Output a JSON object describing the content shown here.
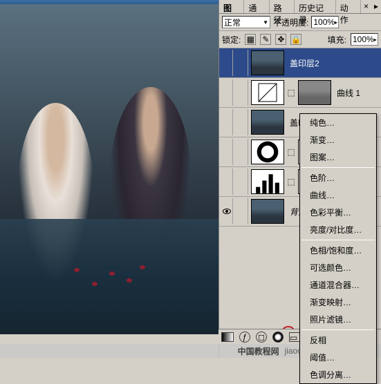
{
  "panel_tabs": {
    "layers": "图层",
    "channels": "通道",
    "paths": "路径",
    "history": "历史记录",
    "actions": "动作"
  },
  "blend": {
    "mode": "正常",
    "opacity_label": "不透明度:",
    "opacity_value": "100%"
  },
  "lock": {
    "label": "锁定:",
    "fill_label": "填充:",
    "fill_value": "100%"
  },
  "layers": [
    {
      "name": "盖印层2",
      "type": "photo",
      "selected": true
    },
    {
      "name": "曲线 1",
      "type": "curves",
      "mask": true
    },
    {
      "name": "盖印层",
      "type": "photo"
    },
    {
      "name": "",
      "type": "levels",
      "mask": true
    },
    {
      "name": "",
      "type": "levels2",
      "mask": true
    },
    {
      "name": "背景",
      "type": "photo",
      "visible": true,
      "italic": true
    }
  ],
  "menu": {
    "solid_color": "纯色…",
    "gradient": "渐变…",
    "pattern": "图案…",
    "levels": "色阶…",
    "curves": "曲线…",
    "color_balance": "色彩平衡…",
    "brightness_contrast": "亮度/对比度…",
    "hue_saturation": "色相/饱和度…",
    "selective_color": "可选颜色…",
    "channel_mixer": "通道混合器…",
    "gradient_map": "渐变映射…",
    "photo_filter": "照片滤镜…",
    "invert": "反相",
    "threshold": "阈值…",
    "posterize": "色调分离…"
  },
  "watermark": {
    "site": "中国教程网",
    "url": "jiaocheng.chazidian.com"
  }
}
